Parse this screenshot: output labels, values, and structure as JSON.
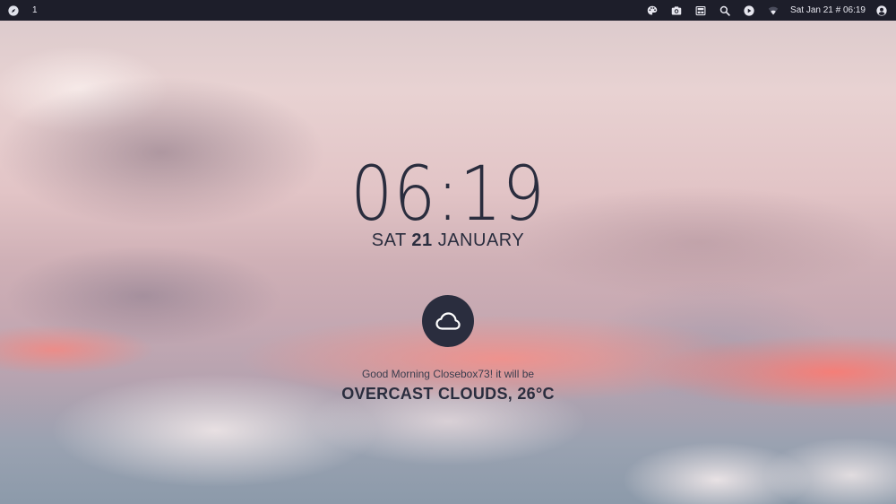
{
  "panel": {
    "workspace": "1",
    "icons": {
      "launcher": "compass-icon",
      "palette": "palette-icon",
      "screenshot": "camera-icon",
      "dashboard": "dashboard-icon",
      "search": "search-icon",
      "media": "play-icon",
      "network": "wifi-icon",
      "user": "user-icon"
    },
    "clock": "Sat Jan 21 # 06:19"
  },
  "widget": {
    "time": "06:19",
    "weekday": "SAT",
    "day": "21",
    "month": "JANUARY",
    "weather_icon": "cloud-icon",
    "greeting": "Good Morning Closebox73! it will be",
    "conditions": "OVERCAST CLOUDS, 26°C"
  },
  "colors": {
    "panel_bg": "#1d1e2a",
    "text_dark": "#2a2d3e"
  }
}
